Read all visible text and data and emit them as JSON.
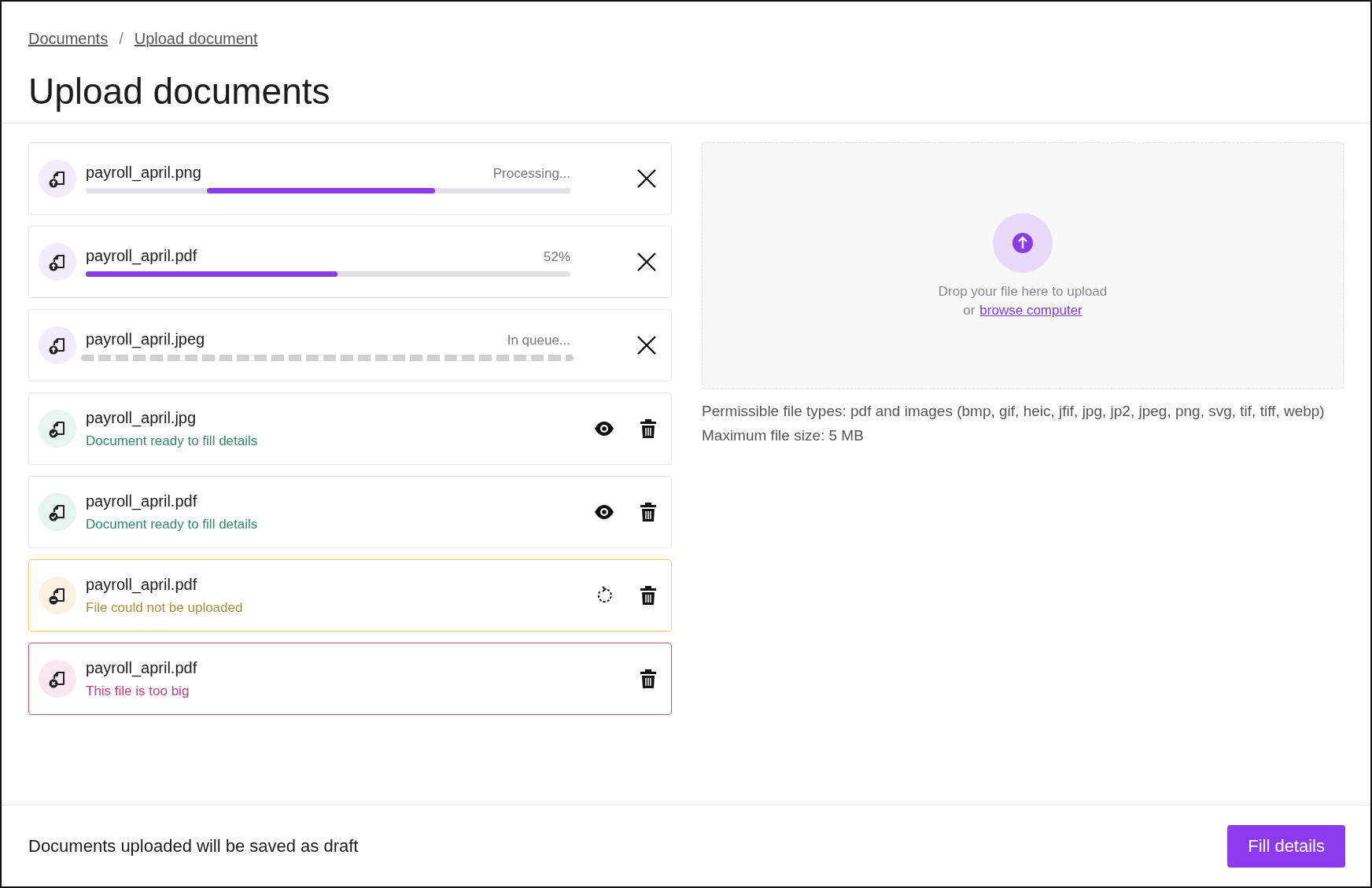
{
  "breadcrumbs": [
    {
      "label": "Documents"
    },
    {
      "label": "Upload document"
    }
  ],
  "breadcrumb_separator": "/",
  "title": "Upload documents",
  "files": [
    {
      "kind": "processing",
      "name": "payroll_april.png",
      "status": "Processing..."
    },
    {
      "kind": "uploading",
      "name": "payroll_april.pdf",
      "status": "52%",
      "level": 0.52
    },
    {
      "kind": "queued",
      "name": "payroll_april.jpeg",
      "status": "In queue..."
    },
    {
      "kind": "ready",
      "name": "payroll_april.jpg",
      "status": "Document ready to fill details"
    },
    {
      "kind": "ready",
      "name": "payroll_april.pdf",
      "status": "Document ready to fill details"
    },
    {
      "kind": "failed",
      "name": "payroll_april.pdf",
      "status": "File could not be uploaded"
    },
    {
      "kind": "too_big",
      "name": "payroll_april.pdf",
      "status": "This file is too big"
    }
  ],
  "dropzone": {
    "prompt": "Drop your file here to upload",
    "or": "or",
    "link": "browse computer"
  },
  "file_types": "Permissible file types: pdf and images (bmp, gif, heic, jfif, jpg, jp2, jpeg, png, svg, tif, tiff, webp)",
  "max_size": "Maximum file size: 5 MB",
  "footer": {
    "note": "Documents uploaded will be saved as draft",
    "button": "Fill details"
  }
}
